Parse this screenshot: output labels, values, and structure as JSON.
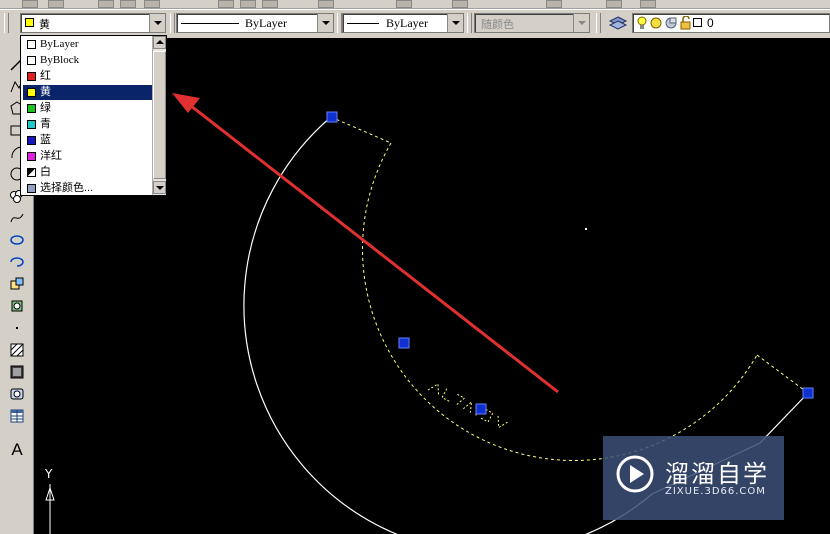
{
  "toolbar": {
    "color_combo": {
      "value": "黄",
      "swatch": "#ffff00"
    },
    "linetype_combo": {
      "value": "ByLayer"
    },
    "lineweight_combo": {
      "value": "ByLayer"
    },
    "plotstyle_combo": {
      "value": "随颜色"
    },
    "layer_combo": {
      "value": "0",
      "icons": [
        "layers-icon",
        "bulb-on-icon",
        "sun-icon",
        "lock-open-icon"
      ]
    }
  },
  "color_dropdown": {
    "items": [
      {
        "label": "ByLayer",
        "swatch": "#ffffff"
      },
      {
        "label": "ByBlock",
        "swatch": "#ffffff"
      },
      {
        "label": "红",
        "swatch": "#e02020"
      },
      {
        "label": "黄",
        "swatch": "#ffff00",
        "selected": true
      },
      {
        "label": "绿",
        "swatch": "#20c020"
      },
      {
        "label": "青",
        "swatch": "#20c8c8"
      },
      {
        "label": "蓝",
        "swatch": "#1818c0"
      },
      {
        "label": "洋红",
        "swatch": "#e020e0"
      },
      {
        "label": "白",
        "swatch": "#ffffff"
      },
      {
        "label": "选择颜色...",
        "swatch": "#ffffff"
      }
    ]
  },
  "draw_toolbar": {
    "icons": [
      "line-icon",
      "polyline-icon",
      "rectangle-icon",
      "arc-icon",
      "circle-icon",
      "revision-cloud-icon",
      "spline-icon",
      "ellipse-icon",
      "ellipse-arc-icon",
      "insert-block-icon",
      "make-block-icon",
      "point-icon",
      "hatch-icon",
      "gradient-icon",
      "region-icon",
      "table-icon",
      "multiline-text-icon"
    ],
    "text_tool_label": "A"
  },
  "ucs": {
    "y_label": "Y"
  },
  "canvas": {
    "background": "#000000",
    "grip_color": "#1030d0",
    "annotation_color": "#e03030"
  },
  "watermark": {
    "brand": "溜溜自学",
    "url": "ZIXUE.3D66.COM"
  }
}
